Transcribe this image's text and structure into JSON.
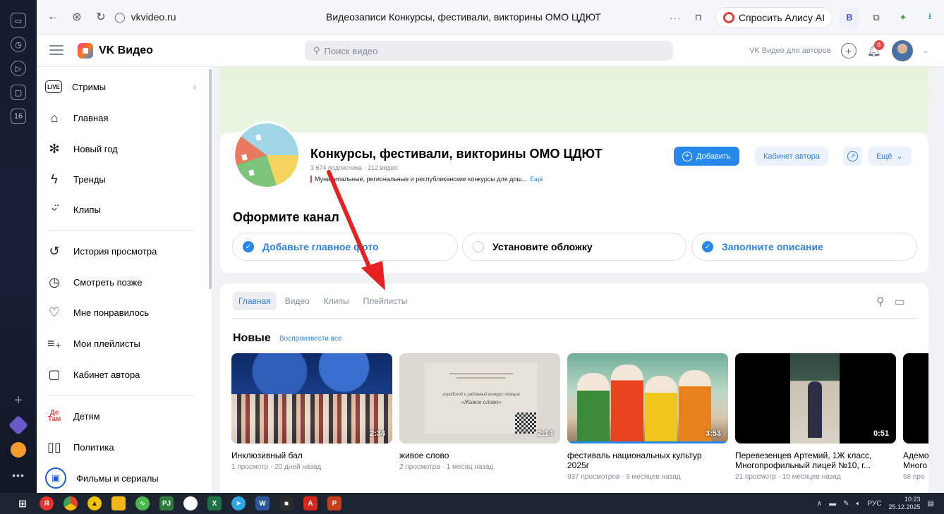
{
  "browser": {
    "url": "vkvideo.ru",
    "page_title": "Видеозаписи Конкурсы, фестивали, викторины ОМО ЦДЮТ",
    "alice_label": "Спросить Алису AI",
    "profile_letter": "В"
  },
  "dock": {
    "badge_number": "16"
  },
  "header": {
    "logo_text": "VK Видео",
    "search_placeholder": "Поиск видео",
    "for_authors": "VK Видео для авторов",
    "notif_count": "9"
  },
  "sidebar": {
    "items": [
      {
        "label": "Стримы",
        "icon": "live-icon"
      },
      {
        "label": "Главная",
        "icon": "home-icon"
      },
      {
        "label": "Новый год",
        "icon": "snowflake-icon"
      },
      {
        "label": "Тренды",
        "icon": "lightning-icon"
      },
      {
        "label": "Клипы",
        "icon": "clips-icon"
      },
      {
        "label": "История просмотра",
        "icon": "history-icon"
      },
      {
        "label": "Смотреть позже",
        "icon": "clock-icon"
      },
      {
        "label": "Мне понравилось",
        "icon": "heart-icon"
      },
      {
        "label": "Мои плейлисты",
        "icon": "playlist-icon"
      },
      {
        "label": "Кабинет автора",
        "icon": "author-cabinet-icon"
      },
      {
        "label": "Детям",
        "icon": "kids-icon"
      },
      {
        "label": "Политика",
        "icon": "book-icon"
      },
      {
        "label": "Фильмы и сериалы",
        "icon": "tv-icon"
      }
    ],
    "live_icon_text": "LIVE",
    "kids_icon_text": "Де Там"
  },
  "channel": {
    "name": "Конкурсы, фестивали, викторины ОМО ЦДЮТ",
    "meta": "3 674 подписчика · 212 видео",
    "description": "Муниципальные, региональные и республиканские конкурсы для дош...",
    "more_link": "Ещё",
    "buttons": {
      "add": "Добавить",
      "author_cabinet": "Кабинет автора",
      "more": "Ещё"
    }
  },
  "setup": {
    "title": "Оформите канал",
    "steps": [
      {
        "label": "Добавьте главное фото",
        "done": true
      },
      {
        "label": "Установите обложку",
        "done": false
      },
      {
        "label": "Заполните описание",
        "done": true
      }
    ]
  },
  "tabs": [
    {
      "label": "Главная",
      "active": true
    },
    {
      "label": "Видео",
      "active": false
    },
    {
      "label": "Клипы",
      "active": false
    },
    {
      "label": "Плейлисты",
      "active": false
    }
  ],
  "section": {
    "title": "Новые",
    "play_all": "Воспроизвести все"
  },
  "videos": [
    {
      "title": "Инклюзивный бал",
      "title2": "",
      "meta": "1 просмотр · 20 дней назад",
      "duration": "2:34",
      "watched": 0
    },
    {
      "title": "живое слово",
      "title2": "",
      "meta": "2 просмотра · 1 месяц назад",
      "duration": "2:14",
      "watched": 0
    },
    {
      "title": "фестиваль национальных культур",
      "title2": "2025г",
      "meta": "937 просмотров · 9 месяцев назад",
      "duration": "3:53",
      "watched": 1.0
    },
    {
      "title": "Перевезенцев Артемий, 1Ж класс,",
      "title2": "Многопрофильный лицей №10, г...",
      "meta": "21 просмотр · 10 месяцев назад",
      "duration": "0:51",
      "watched": 0
    },
    {
      "title": "Адемо",
      "title2": "Много",
      "meta": "68 про",
      "duration": "",
      "watched": 0
    }
  ],
  "thumb2_text": {
    "line1": "городской и районный конкурс чтецов",
    "line2": "«Живое слово»"
  },
  "taskbar": {
    "lang": "РУС",
    "time": "10:23",
    "date": "25.12.2025"
  },
  "colors": {
    "accent": "#2688eb",
    "annotation_arrow": "#e8201f"
  }
}
